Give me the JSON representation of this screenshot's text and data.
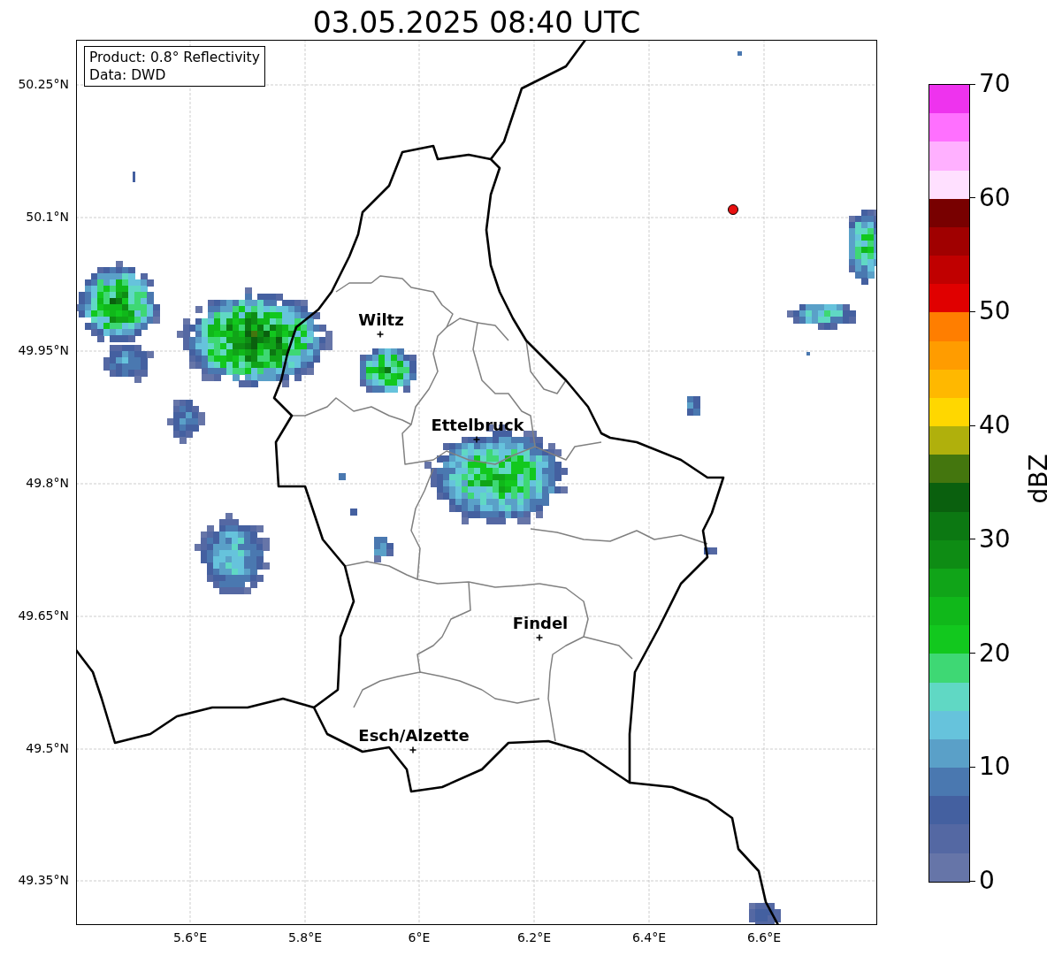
{
  "title": "03.05.2025 08:40 UTC",
  "info_box": {
    "lines": [
      "Product: 0.8° Reflectivity",
      "Data: DWD"
    ]
  },
  "map": {
    "lat_ticks": [
      "50.25°N",
      "50.1°N",
      "49.95°N",
      "49.8°N",
      "49.65°N",
      "49.5°N",
      "49.35°N"
    ],
    "lon_ticks": [
      "5.6°E",
      "5.8°E",
      "6°E",
      "6.2°E",
      "6.4°E",
      "6.6°E"
    ],
    "cities": [
      {
        "name": "Wiltz"
      },
      {
        "name": "Ettelbruck"
      },
      {
        "name": "Findel"
      },
      {
        "name": "Esch/Alzette"
      }
    ]
  },
  "colorbar": {
    "label": "dBZ",
    "ticks": [
      "70",
      "60",
      "50",
      "40",
      "30",
      "20",
      "10",
      "0"
    ],
    "bands": [
      {
        "color": "#ee33ee"
      },
      {
        "color": "#ff70ff"
      },
      {
        "color": "#ffb0ff"
      },
      {
        "color": "#ffe0ff"
      },
      {
        "color": "#780000"
      },
      {
        "color": "#a00000"
      },
      {
        "color": "#c00000"
      },
      {
        "color": "#e00000"
      },
      {
        "color": "#ff7e00"
      },
      {
        "color": "#ff9c00"
      },
      {
        "color": "#ffb800"
      },
      {
        "color": "#ffd700"
      },
      {
        "color": "#b0b00c"
      },
      {
        "color": "#44760e"
      },
      {
        "color": "#0a600e"
      },
      {
        "color": "#0c7812"
      },
      {
        "color": "#0e8c14"
      },
      {
        "color": "#10a418"
      },
      {
        "color": "#10b81a"
      },
      {
        "color": "#12c81e"
      },
      {
        "color": "#3ed874"
      },
      {
        "color": "#60d8c4"
      },
      {
        "color": "#66c3dc"
      },
      {
        "color": "#5aa0c8"
      },
      {
        "color": "#4a78b0"
      },
      {
        "color": "#4460a0"
      },
      {
        "color": "#5468a3"
      },
      {
        "color": "#6675a8"
      }
    ]
  }
}
